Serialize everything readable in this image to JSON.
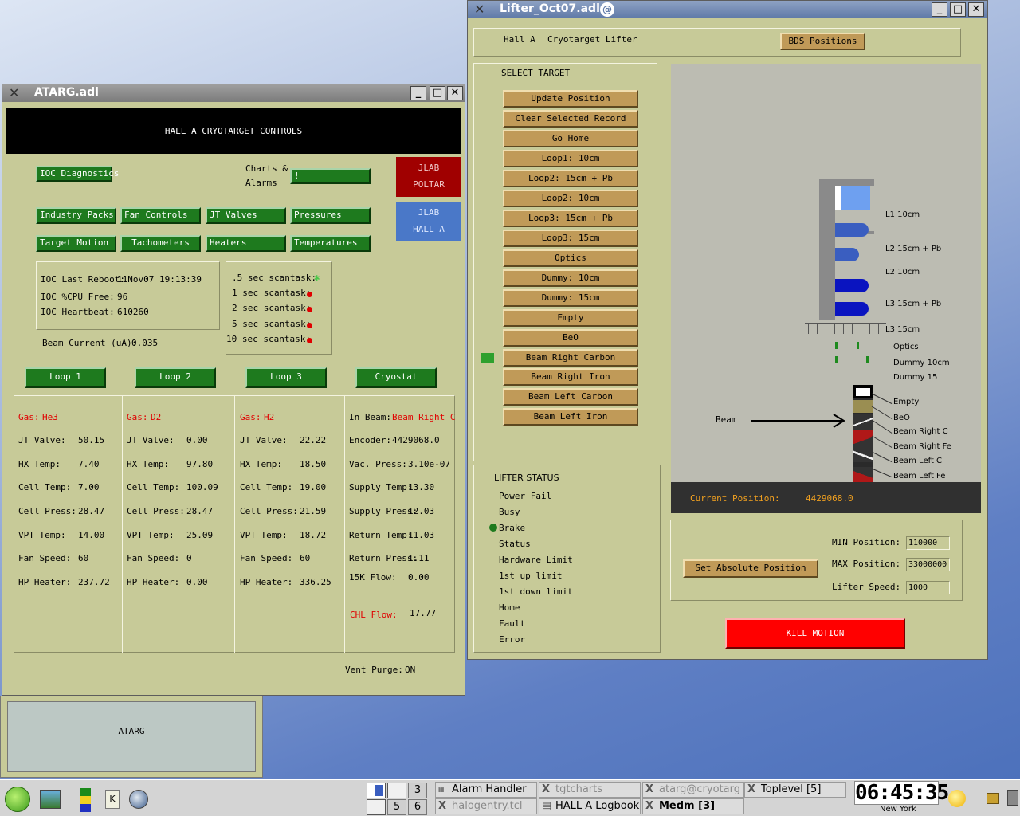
{
  "atarg": {
    "title": "ATARG.adl",
    "banner": "HALL A CRYOTARGET CONTROLS",
    "ioc_diagnostics": "IOC Diagnostics",
    "charts_label_1": "Charts &",
    "charts_label_2": "Alarms",
    "charts_btn": "!",
    "jlab_poltar_1": "JLAB",
    "jlab_poltar_2": "POLTAR",
    "jlab_halla_1": "JLAB",
    "jlab_halla_2": "HALL A",
    "buttons": [
      "Industry Packs",
      "Fan Controls",
      "JT Valves",
      "Pressures",
      "Target Motion",
      "Tachometers",
      "Heaters",
      "Temperatures"
    ],
    "ioc_last_reboot_label": "IOC Last Reboot:",
    "ioc_last_reboot": "11Nov07 19:13:39",
    "ioc_cpu_label": "IOC %CPU Free:",
    "ioc_cpu": "96",
    "ioc_heartbeat_label": "IOC Heartbeat:",
    "ioc_heartbeat": "610260",
    "scantasks": [
      ".5 sec scantask:",
      "1 sec scantask:",
      "2 sec scantask:",
      "5 sec scantask:",
      "10 sec scantask:"
    ],
    "beam_current_label": "Beam Current (uA):",
    "beam_current": "0.035",
    "loop_buttons": [
      "Loop 1",
      "Loop 2",
      "Loop 3",
      "Cryostat"
    ],
    "row_labels": [
      "JT Valve:",
      "HX Temp:",
      "Cell Temp:",
      "Cell Press:",
      "VPT Temp:",
      "Fan Speed:",
      "HP Heater:"
    ],
    "gas_label": "Gas:",
    "loops": [
      {
        "gas": "He3",
        "values": [
          "50.15",
          "7.40",
          "7.00",
          "28.47",
          "14.00",
          "60",
          "237.72"
        ]
      },
      {
        "gas": "D2",
        "values": [
          "0.00",
          "97.80",
          "100.09",
          "28.47",
          "25.09",
          "0",
          "0.00"
        ]
      },
      {
        "gas": "H2",
        "values": [
          "22.22",
          "18.50",
          "19.00",
          "21.59",
          "18.72",
          "60",
          "336.25"
        ]
      }
    ],
    "cryostat": {
      "in_beam_label": "In Beam:",
      "in_beam": "Beam Right C",
      "labels": [
        "Encoder:",
        "Vac. Press:",
        "Supply Temp:",
        "Supply Press:",
        "Return Temp:",
        "Return Press:",
        "15K Flow:"
      ],
      "values": [
        "4429068.0",
        "3.10e-07",
        "13.30",
        "12.03",
        "11.03",
        "1.11",
        "0.00"
      ],
      "chl_flow_label": "CHL Flow:",
      "chl_flow": "17.77"
    },
    "vent_purge_label": "Vent Purge:",
    "vent_purge": "ON"
  },
  "atarg_icon": {
    "label": "ATARG"
  },
  "lifter": {
    "title": "Lifter_Oct07.adl",
    "hall": "Hall A",
    "subtitle": "Cryotarget Lifter",
    "bds_button": "BDS Positions",
    "select_target": "SELECT TARGET",
    "targets": [
      "Update Position",
      "Clear Selected Record",
      "Go Home",
      "Loop1: 10cm",
      "Loop2: 15cm + Pb",
      "Loop2: 10cm",
      "Loop3: 15cm + Pb",
      "Loop3: 15cm",
      "Optics",
      "Dummy: 10cm",
      "Dummy: 15cm",
      "Empty",
      "BeO",
      "Beam Right Carbon",
      "Beam Right Iron",
      "Beam Left Carbon",
      "Beam Left Iron"
    ],
    "selected_target": "Beam Right Carbon",
    "lifter_status": "LIFTER STATUS",
    "status_items": [
      "Power Fail",
      "Busy",
      "Brake",
      "Status",
      "Hardware Limit",
      "1st up limit",
      "1st down limit",
      "Home",
      "Fault",
      "Error"
    ],
    "diagram_labels": [
      "L1 10cm",
      "L2 15cm + Pb",
      "L2 10cm",
      "L3 15cm + Pb",
      "L3 15cm",
      "Optics",
      "Dummy 10cm",
      "Dummy 15"
    ],
    "solid_labels": [
      "Empty",
      "BeO",
      "Beam Right C",
      "Beam Right Fe",
      "Beam Left C",
      "Beam Left Fe"
    ],
    "beam_label": "Beam",
    "current_position_label": "Current Position:",
    "current_position": "4429068.0",
    "set_absolute": "Set Absolute Position",
    "min_label": "MIN Position:",
    "min_value": "110000",
    "max_label": "MAX Position:",
    "max_value": "33000000",
    "speed_label": "Lifter Speed:",
    "speed_value": "1000",
    "kill_motion": "KILL MOTION"
  },
  "taskbar": {
    "workspaces": [
      "3",
      "5",
      "6"
    ],
    "tasks": [
      "Alarm Handler",
      "tgtcharts",
      "atarg@cryotarg",
      "Toplevel [5]",
      "halogentry.tcl",
      "HALL A Logbook",
      "Medm [3]"
    ],
    "clock": "06:45:35",
    "clock_city": "New York"
  },
  "colors": {
    "panel": "#c7ca98",
    "green_button": "#1e7a1e",
    "tan_button": "#c09a58",
    "alarm_red": "#e00000",
    "kill_red": "#ff0000",
    "poltar_red": "#a00000",
    "halla_blue": "#4a78c8"
  }
}
